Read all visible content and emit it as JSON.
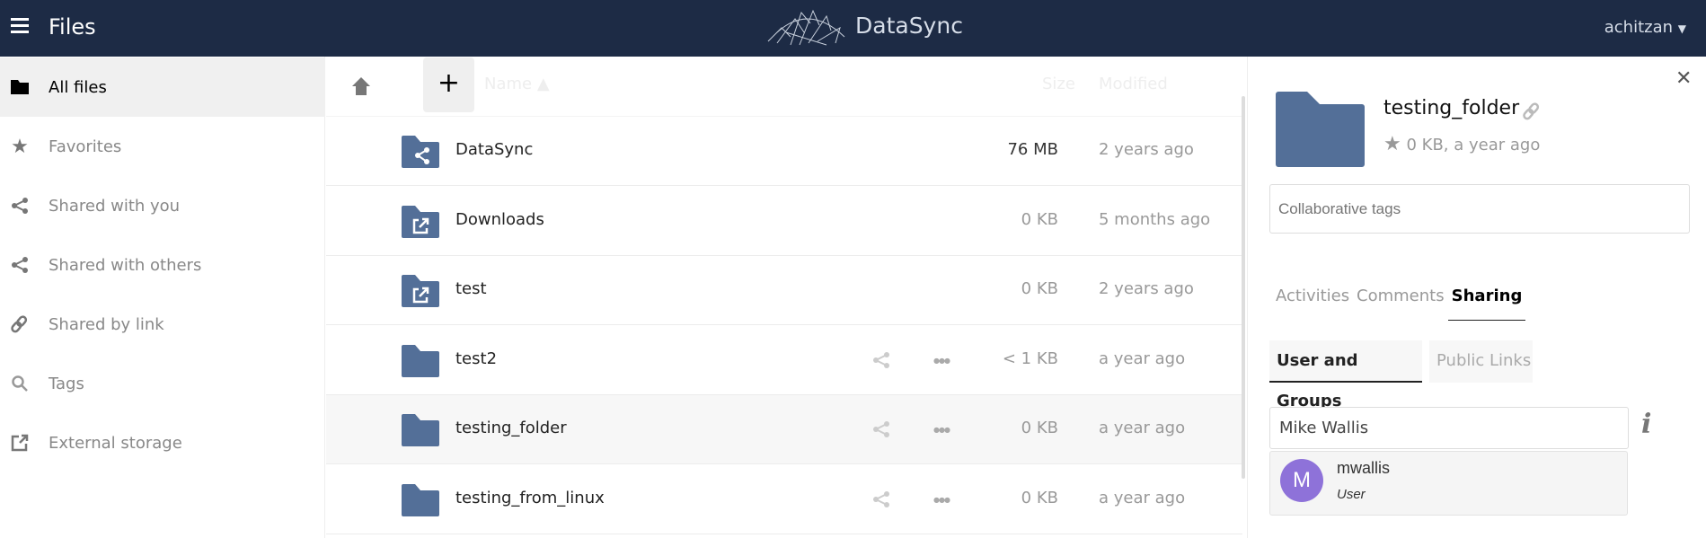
{
  "header": {
    "app_title": "Files",
    "brand": "DataSync",
    "user": "achitzan",
    "colors": {
      "bar": "#1d2b45",
      "folder": "#536f98",
      "avatar": "#8e72d9"
    }
  },
  "sidebar": {
    "items": [
      {
        "label": "All files",
        "icon": "folder-icon",
        "active": true
      },
      {
        "label": "Favorites",
        "icon": "star-icon"
      },
      {
        "label": "Shared with you",
        "icon": "share-icon"
      },
      {
        "label": "Shared with others",
        "icon": "share-icon"
      },
      {
        "label": "Shared by link",
        "icon": "link-icon"
      },
      {
        "label": "Tags",
        "icon": "search-icon"
      },
      {
        "label": "External storage",
        "icon": "external-icon"
      }
    ]
  },
  "files": {
    "columns": {
      "name": "Name ▲",
      "size": "Size",
      "modified": "Modified"
    },
    "new_label": "+",
    "rows": [
      {
        "name": "DataSync",
        "size": "76 MB",
        "modified": "2 years ago",
        "icon": "shared-folder-icon"
      },
      {
        "name": "Downloads",
        "size": "0 KB",
        "modified": "5 months ago",
        "icon": "external-folder-icon"
      },
      {
        "name": "test",
        "size": "0 KB",
        "modified": "2 years ago",
        "icon": "external-folder-icon"
      },
      {
        "name": "test2",
        "size": "< 1 KB",
        "modified": "a year ago",
        "icon": "folder-icon"
      },
      {
        "name": "testing_folder",
        "size": "0 KB",
        "modified": "a year ago",
        "icon": "folder-icon",
        "selected": true
      },
      {
        "name": "testing_from_linux",
        "size": "0 KB",
        "modified": "a year ago",
        "icon": "folder-icon"
      }
    ]
  },
  "details": {
    "name": "testing_folder",
    "meta": "0 KB, a year ago",
    "tags_placeholder": "Collaborative tags",
    "tabs": [
      "Activities",
      "Comments",
      "Sharing"
    ],
    "subtabs": [
      "User and Groups",
      "Public Links"
    ],
    "share_input": "Mike Wallis",
    "suggestion": {
      "initial": "M",
      "name": "mwallis",
      "type": "User"
    }
  }
}
